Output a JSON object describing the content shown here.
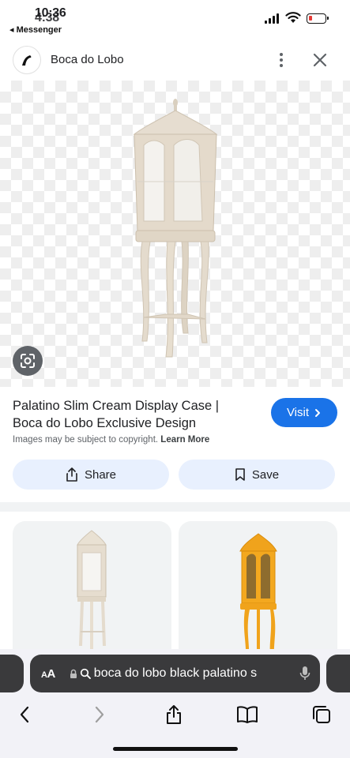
{
  "status_bar": {
    "time": "10:36",
    "time_ghost": "4:38",
    "back_app": "◂ Messenger"
  },
  "header": {
    "site_name": "Boca do Lobo"
  },
  "result": {
    "title": "Palatino Slim Cream Display Case | Boca do Lobo Exclusive Design",
    "visit_label": "Visit",
    "copyright_text": "Images may be subject to copyright.",
    "learn_more": "Learn More",
    "share_label": "Share",
    "save_label": "Save"
  },
  "related": [
    {
      "color": "#e9e1d3",
      "name": "cream cabinet"
    },
    {
      "color": "#f0a31c",
      "name": "orange cabinet"
    }
  ],
  "browser": {
    "aa_label": "AA",
    "url_text": "boca do lobo black  palatino s"
  },
  "colors": {
    "accent": "#1a73e8",
    "action_bg": "#e8f0fe",
    "url_bar": "#3a3a3c"
  },
  "icons": [
    "signal-icon",
    "wifi-icon",
    "battery-icon",
    "site-logo-icon",
    "more-vert-icon",
    "close-icon",
    "lens-icon",
    "chevron-right-icon",
    "share-icon",
    "bookmark-icon",
    "lock-icon",
    "search-icon",
    "mic-icon",
    "back-icon",
    "forward-icon",
    "share-sheet-icon",
    "bookmarks-icon",
    "tabs-icon"
  ]
}
